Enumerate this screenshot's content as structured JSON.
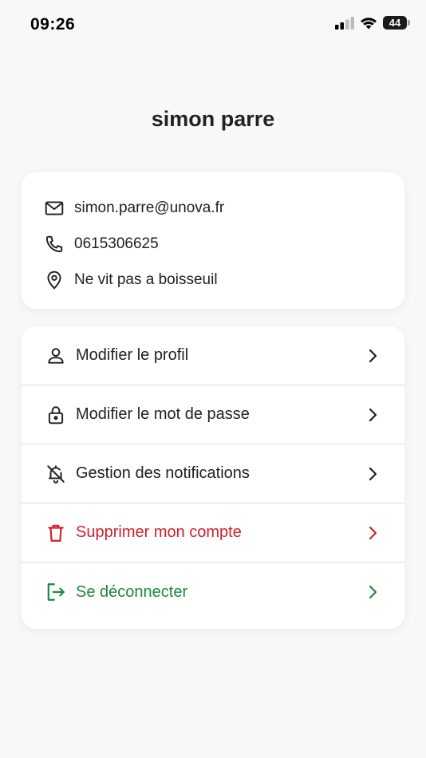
{
  "status_bar": {
    "time": "09:26",
    "battery_level": "44"
  },
  "profile": {
    "name": "simon parre"
  },
  "contact": {
    "email": "simon.parre@unova.fr",
    "phone": "0615306625",
    "location": "Ne vit pas a boisseuil"
  },
  "menu": {
    "edit_profile": "Modifier le profil",
    "change_password": "Modifier le mot de passe",
    "notifications": "Gestion des notifications",
    "delete_account": "Supprimer mon compte",
    "logout": "Se déconnecter"
  },
  "colors": {
    "danger": "#d0202a",
    "success": "#1a8a3c",
    "text": "#1f1f1f"
  }
}
